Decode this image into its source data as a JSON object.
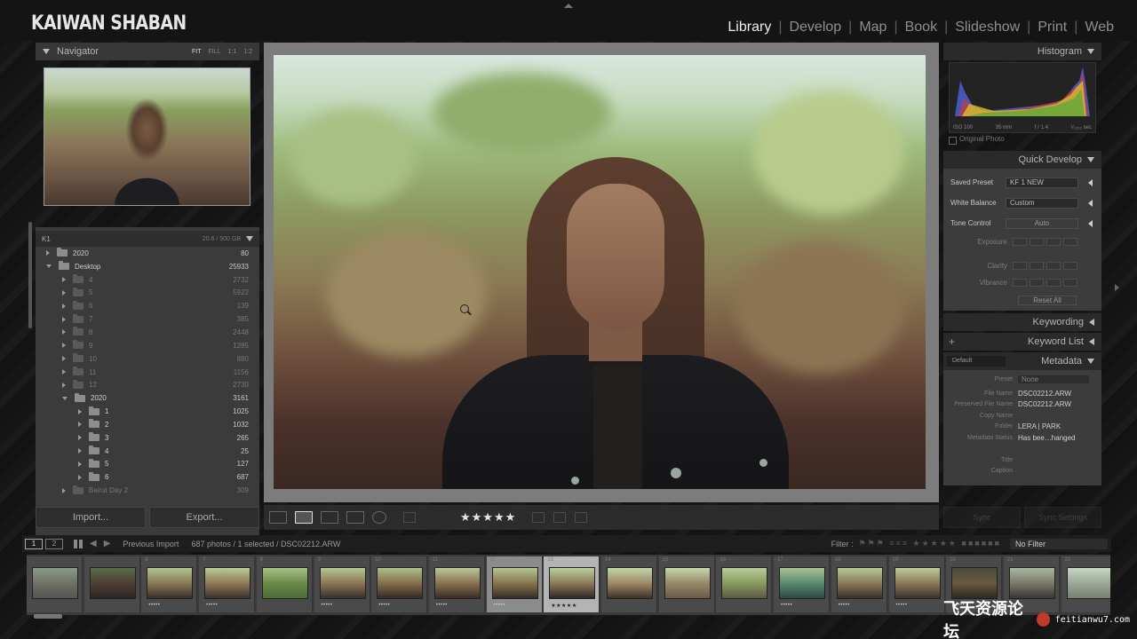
{
  "brand": "KAIWAN SHABAN",
  "modules": [
    {
      "label": "Library",
      "active": true
    },
    {
      "label": "Develop",
      "active": false
    },
    {
      "label": "Map",
      "active": false
    },
    {
      "label": "Book",
      "active": false
    },
    {
      "label": "Slideshow",
      "active": false
    },
    {
      "label": "Print",
      "active": false
    },
    {
      "label": "Web",
      "active": false
    }
  ],
  "navigator": {
    "title": "Navigator",
    "options": [
      "FIT",
      "FILL",
      "1:1",
      "1:2"
    ]
  },
  "folders": {
    "volume": "K1",
    "volume_count": "20.6 / 500 GB",
    "rows": [
      {
        "name": "2020",
        "count": "80",
        "indent": 0,
        "open": false,
        "dim": false
      },
      {
        "name": "Desktop",
        "count": "25933",
        "indent": 0,
        "open": true,
        "dim": false
      },
      {
        "name": "4",
        "count": "2732",
        "indent": 1,
        "open": false,
        "dim": true
      },
      {
        "name": "5",
        "count": "5922",
        "indent": 1,
        "open": false,
        "dim": true
      },
      {
        "name": "6",
        "count": "139",
        "indent": 1,
        "open": false,
        "dim": true
      },
      {
        "name": "7",
        "count": "385",
        "indent": 1,
        "open": false,
        "dim": true
      },
      {
        "name": "8",
        "count": "2448",
        "indent": 1,
        "open": false,
        "dim": true
      },
      {
        "name": "9",
        "count": "1285",
        "indent": 1,
        "open": false,
        "dim": true
      },
      {
        "name": "10",
        "count": "880",
        "indent": 1,
        "open": false,
        "dim": true
      },
      {
        "name": "11",
        "count": "1156",
        "indent": 1,
        "open": false,
        "dim": true
      },
      {
        "name": "12",
        "count": "2730",
        "indent": 1,
        "open": false,
        "dim": true
      },
      {
        "name": "2020",
        "count": "3161",
        "indent": 1,
        "open": true,
        "dim": false
      },
      {
        "name": "1",
        "count": "1025",
        "indent": 2,
        "open": false,
        "dim": false
      },
      {
        "name": "2",
        "count": "1032",
        "indent": 2,
        "open": false,
        "dim": false
      },
      {
        "name": "3",
        "count": "265",
        "indent": 2,
        "open": false,
        "dim": false
      },
      {
        "name": "4",
        "count": "25",
        "indent": 2,
        "open": false,
        "dim": false
      },
      {
        "name": "5",
        "count": "127",
        "indent": 2,
        "open": false,
        "dim": false
      },
      {
        "name": "6",
        "count": "687",
        "indent": 2,
        "open": false,
        "dim": false
      },
      {
        "name": "Beirut Day 2",
        "count": "309",
        "indent": 1,
        "open": false,
        "dim": true
      }
    ]
  },
  "buttons": {
    "import": "Import...",
    "export": "Export...",
    "sync": "Sync",
    "sync_settings": "Sync Settings"
  },
  "toolbar": {
    "stars": "★★★★★"
  },
  "histogram": {
    "title": "Histogram",
    "iso": "ISO 100",
    "focal": "35 mm",
    "aperture": "f / 1.4",
    "shutter": "¹⁄₁₂₅₀ sec",
    "original": "Original Photo"
  },
  "quick_develop": {
    "title": "Quick Develop",
    "saved_preset_label": "Saved Preset",
    "saved_preset": "KF 1 NEW",
    "wb_label": "White Balance",
    "wb": "Custom",
    "tone_label": "Tone Control",
    "auto": "Auto",
    "exposure": "Exposure",
    "clarity": "Clarity",
    "vibrance": "Vibrance",
    "reset": "Reset All"
  },
  "keywording": "Keywording",
  "keyword_list": "Keyword List",
  "metadata": {
    "title": "Metadata",
    "default": "Default",
    "preset_label": "Preset",
    "preset": "None",
    "fields": [
      {
        "k": "File Name",
        "v": "DSC02212.ARW"
      },
      {
        "k": "Preserved File Name",
        "v": "DSC02212.ARW"
      },
      {
        "k": "Copy Name",
        "v": ""
      },
      {
        "k": "Folder",
        "v": "LERA | PARK"
      },
      {
        "k": "Metadata Status",
        "v": "Has bee…hanged"
      },
      {
        "k": "",
        "v": ""
      },
      {
        "k": "Title",
        "v": ""
      },
      {
        "k": "Caption",
        "v": ""
      }
    ]
  },
  "filmstrip_bar": {
    "page1": "1",
    "page2": "2",
    "source": "Previous Import",
    "info": "687 photos / 1 selected / DSC02212.ARW",
    "filter_label": "Filter :",
    "filter_value": "No Filter"
  },
  "filmstrip": {
    "numbers": [
      "",
      "",
      "6",
      "7",
      "8",
      "9",
      "10",
      "11",
      "12",
      "13",
      "14",
      "15",
      "16",
      "17",
      "18",
      "19",
      "20",
      "21",
      "22"
    ],
    "stars": [
      "",
      "",
      "•••••",
      "•••••",
      "",
      "•••••",
      "•••••",
      "•••••",
      "•••••",
      "★★★★★",
      "",
      "",
      "",
      "•••••",
      "•••••",
      "•••••",
      "•••••",
      "•••••",
      ""
    ]
  },
  "watermark": {
    "cn": "飞天资源论坛",
    "en": "feitianwu7.com"
  }
}
